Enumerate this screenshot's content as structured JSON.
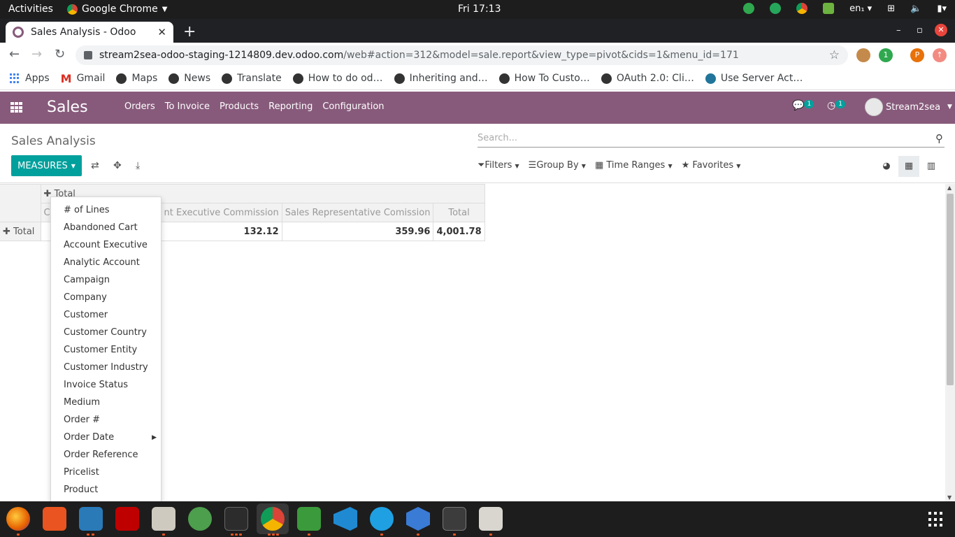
{
  "gnome": {
    "activities": "Activities",
    "app": "Google Chrome",
    "clock": "Fri 17:13",
    "lang": "en₁"
  },
  "chrome": {
    "tab_title": "Sales Analysis - Odoo",
    "url_host": "stream2sea-odoo-staging-1214809.dev.odoo.com",
    "url_path": "/web#action=312&model=sale.report&view_type=pivot&cids=1&menu_id=171",
    "profile_initial": "P",
    "ext_badge": "1",
    "bookmarks": [
      "Apps",
      "Gmail",
      "Maps",
      "News",
      "Translate",
      "How to do od…",
      "Inheriting and…",
      "How To Custo…",
      "OAuth 2.0: Cli…",
      "Use Server Act…"
    ]
  },
  "odoo": {
    "app_name": "Sales",
    "menu": [
      "Orders",
      "To Invoice",
      "Products",
      "Reporting",
      "Configuration"
    ],
    "messages_badge": "1",
    "activities_badge": "1",
    "user": "Stream2sea"
  },
  "control_panel": {
    "breadcrumb": "Sales Analysis",
    "search_placeholder": "Search...",
    "measures_label": "MEASURES",
    "filters": "Filters",
    "group_by": "Group By",
    "time_ranges": "Time Ranges",
    "favorites": "Favorites"
  },
  "pivot": {
    "col_header_total": "Total",
    "measure_headers": [
      "Co",
      "nt Executive Commission",
      "Sales Representative Comission",
      "Total"
    ],
    "row_header": "Total",
    "values": [
      "132.12",
      "359.96",
      "4,001.78"
    ]
  },
  "measures_dropdown": {
    "items": [
      "# of Lines",
      "Abandoned Cart",
      "Account Executive",
      "Analytic Account",
      "Campaign",
      "Company",
      "Customer",
      "Customer Country",
      "Customer Entity",
      "Customer Industry",
      "Invoice Status",
      "Medium",
      "Order #",
      "Order Date",
      "Order Reference",
      "Pricelist",
      "Product"
    ]
  },
  "colors": {
    "odoo_purple": "#875a7b",
    "odoo_teal": "#00a09d"
  }
}
